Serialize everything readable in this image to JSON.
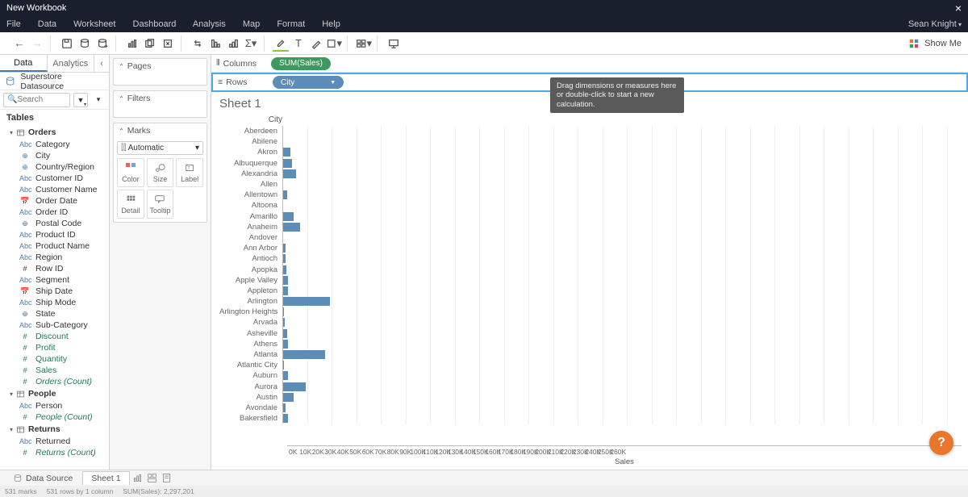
{
  "title": "New Workbook",
  "user": "Sean Knight",
  "menus": [
    "File",
    "Data",
    "Worksheet",
    "Dashboard",
    "Analysis",
    "Map",
    "Format",
    "Help"
  ],
  "showme": "Show Me",
  "side_tabs": {
    "data": "Data",
    "analytics": "Analytics"
  },
  "datasource": "Superstore Datasource",
  "search_placeholder": "Search",
  "tables_label": "Tables",
  "tables": [
    {
      "name": "Orders",
      "dims": [
        {
          "icon": "Abc",
          "label": "Category"
        },
        {
          "icon": "globe",
          "label": "City"
        },
        {
          "icon": "globe",
          "label": "Country/Region"
        },
        {
          "icon": "Abc",
          "label": "Customer ID"
        },
        {
          "icon": "Abc",
          "label": "Customer Name"
        },
        {
          "icon": "cal",
          "label": "Order Date"
        },
        {
          "icon": "Abc",
          "label": "Order ID"
        },
        {
          "icon": "globe",
          "label": "Postal Code"
        },
        {
          "icon": "Abc",
          "label": "Product ID"
        },
        {
          "icon": "Abc",
          "label": "Product Name"
        },
        {
          "icon": "Abc",
          "label": "Region"
        },
        {
          "icon": "hash",
          "label": "Row ID"
        },
        {
          "icon": "Abc",
          "label": "Segment"
        },
        {
          "icon": "cal",
          "label": "Ship Date"
        },
        {
          "icon": "Abc",
          "label": "Ship Mode"
        },
        {
          "icon": "globe",
          "label": "State"
        },
        {
          "icon": "Abc",
          "label": "Sub-Category"
        }
      ],
      "meas": [
        {
          "icon": "hash",
          "label": "Discount"
        },
        {
          "icon": "hash",
          "label": "Profit"
        },
        {
          "icon": "hash",
          "label": "Quantity"
        },
        {
          "icon": "hash",
          "label": "Sales"
        },
        {
          "icon": "hash",
          "label": "Orders (Count)",
          "italic": true
        }
      ]
    },
    {
      "name": "People",
      "dims": [
        {
          "icon": "Abc",
          "label": "Person"
        }
      ],
      "meas": [
        {
          "icon": "hash",
          "label": "People (Count)",
          "italic": true
        }
      ]
    },
    {
      "name": "Returns",
      "dims": [
        {
          "icon": "Abc",
          "label": "Returned"
        }
      ],
      "meas": [
        {
          "icon": "hash",
          "label": "Returns (Count)",
          "italic": true
        }
      ]
    }
  ],
  "cards": {
    "pages": "Pages",
    "filters": "Filters",
    "marks": "Marks",
    "automatic": "Automatic",
    "cells": [
      "Color",
      "Size",
      "Label",
      "Detail",
      "Tooltip"
    ]
  },
  "shelves": {
    "columns": "Columns",
    "columns_pill": "SUM(Sales)",
    "rows": "Rows",
    "rows_pill": "City"
  },
  "tooltip_text": "Drag dimensions or measures here or double-click to start a new calculation.",
  "sheet_title": "Sheet 1",
  "chart_data": {
    "type": "bar",
    "title": "City",
    "xlabel": "Sales",
    "xticks": [
      "0K",
      "10K",
      "20K",
      "30K",
      "40K",
      "50K",
      "60K",
      "70K",
      "80K",
      "90K",
      "100K",
      "110K",
      "120K",
      "130K",
      "140K",
      "150K",
      "160K",
      "170K",
      "180K",
      "190K",
      "200K",
      "210K",
      "220K",
      "230K",
      "240K",
      "250K",
      "260K"
    ],
    "xlim": [
      0,
      260000
    ],
    "categories": [
      "Aberdeen",
      "Abilene",
      "Akron",
      "Albuquerque",
      "Alexandria",
      "Allen",
      "Allentown",
      "Altoona",
      "Amarillo",
      "Anaheim",
      "Andover",
      "Ann Arbor",
      "Antioch",
      "Apopka",
      "Apple Valley",
      "Appleton",
      "Arlington",
      "Arlington Heights",
      "Arvada",
      "Asheville",
      "Athens",
      "Atlanta",
      "Atlantic City",
      "Auburn",
      "Aurora",
      "Austin",
      "Avondale",
      "Bakersfield"
    ],
    "values": [
      0,
      0,
      3000,
      3500,
      5000,
      0,
      1500,
      0,
      4000,
      6500,
      0,
      1000,
      1000,
      1200,
      2000,
      1800,
      18500,
      200,
      600,
      1500,
      2000,
      16500,
      200,
      1800,
      9000,
      4200,
      1000,
      1800
    ]
  },
  "bottom": {
    "data_source": "Data Source",
    "sheet1": "Sheet 1"
  },
  "status": {
    "marks": "531 marks",
    "rows": "531 rows by 1 column",
    "sum": "SUM(Sales): 2,297,201"
  },
  "help": "?"
}
